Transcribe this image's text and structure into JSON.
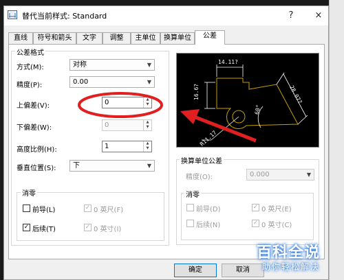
{
  "window": {
    "title": "替代当前样式: Standard",
    "help_glyph": "?",
    "close_glyph": "×"
  },
  "tabs": [
    "直线",
    "符号和箭头",
    "文字",
    "调整",
    "主单位",
    "换算单位",
    "公差"
  ],
  "tolerance_format": {
    "group_title": "公差格式",
    "method_label": "方式(M):",
    "method_value": "对称",
    "precision_label": "精度(P):",
    "precision_value": "0.00",
    "upper_label": "上偏差(V):",
    "upper_value": "0",
    "lower_label": "下偏差(W):",
    "lower_value": "0",
    "height_label": "高度比例(H):",
    "height_value": "1",
    "vpos_label": "垂直位置(S):",
    "vpos_value": "下"
  },
  "zero_suppression": {
    "group_title": "消零",
    "leading_label": "前导(L)",
    "leading_checked": false,
    "trailing_label": "后续(T)",
    "trailing_checked": true,
    "feet_label": "0 英尺(F)",
    "inches_label": "0 英寸(I)"
  },
  "alt_units": {
    "group_title": "换算单位公差",
    "precision_label": "精度(O):",
    "precision_value": "0.000",
    "zero_title": "消零",
    "leading_label": "前导(D)",
    "trailing_label": "后续(N)",
    "feet_label": "0 英尺(E)",
    "inches_label": "0 英寸(C)"
  },
  "preview": {
    "dim_top": "14.11?",
    "dim_left": "16.6?",
    "dim_right": "28.07?",
    "dim_radius": "R11.17",
    "dim_angle": "60°"
  },
  "buttons": {
    "ok": "确定",
    "cancel": "取消"
  },
  "watermark": {
    "line1": "百科全说",
    "line2": "助你轻松解决"
  },
  "colors": {
    "highlight_red": "#e02020",
    "drawing_yellow": "#c8a000",
    "watermark_blue": "#1e6fd6"
  }
}
